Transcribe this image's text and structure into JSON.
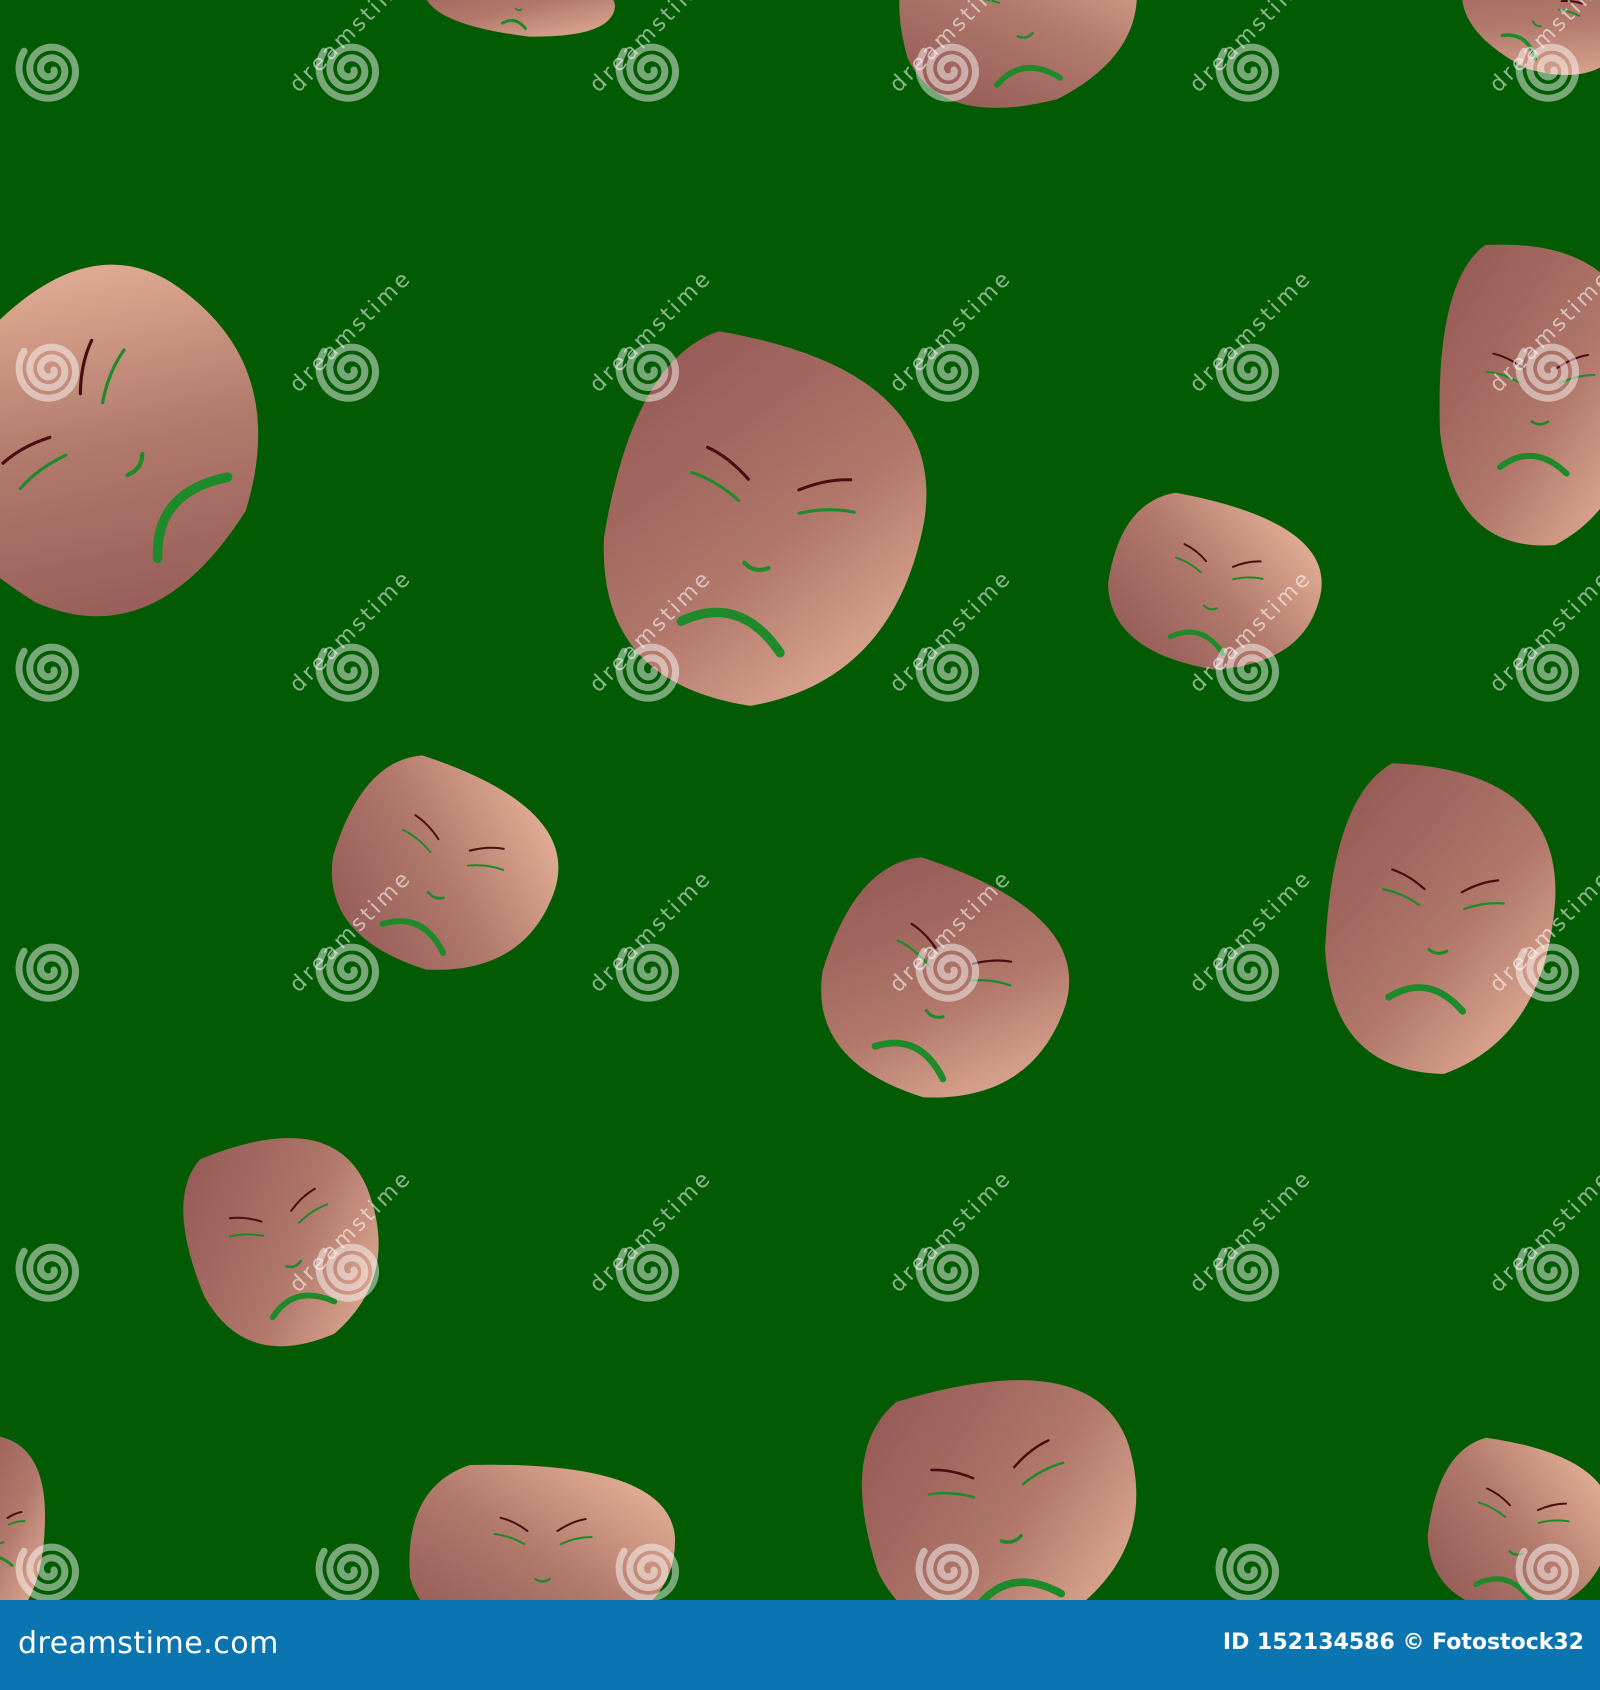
{
  "watermark": {
    "text": "dreamstime"
  },
  "colors": {
    "background": "#025b03",
    "footer": "#0a75b0",
    "face_light": "#e9b39a",
    "face_dark": "#925855",
    "feature_green": "#1f8a2a",
    "feature_dark": "#4a0d12"
  },
  "footer": {
    "site": "dreamstime.com",
    "stock": "ID 152134586 © Fotostock32"
  }
}
